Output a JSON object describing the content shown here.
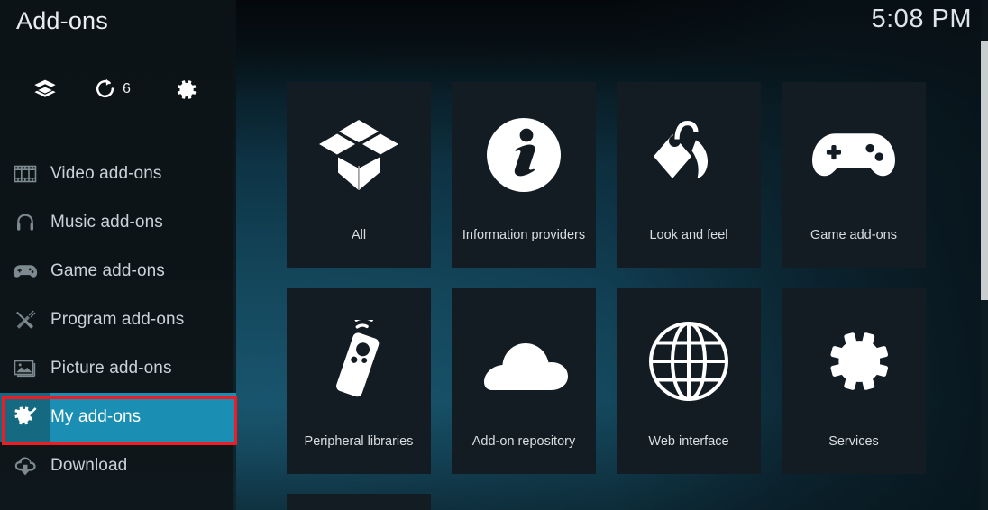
{
  "header": {
    "title": "Add-ons",
    "clock": "5:08 PM"
  },
  "sidebar": {
    "tools": [
      {
        "name": "install-from-package-icon",
        "icon": "package-icon",
        "label": ""
      },
      {
        "name": "check-for-updates-icon",
        "icon": "refresh-icon",
        "label": "6"
      },
      {
        "name": "addon-settings-icon",
        "icon": "gear-icon",
        "label": ""
      }
    ],
    "items": [
      {
        "label": "Video add-ons",
        "icon": "film-icon",
        "selected": false
      },
      {
        "label": "Music add-ons",
        "icon": "headphones-icon",
        "selected": false
      },
      {
        "label": "Game add-ons",
        "icon": "gamepad-icon",
        "selected": false
      },
      {
        "label": "Program add-ons",
        "icon": "tools-icon",
        "selected": false
      },
      {
        "label": "Picture add-ons",
        "icon": "picture-icon",
        "selected": false
      },
      {
        "label": "My add-ons",
        "icon": "my-addons-icon",
        "selected": true
      },
      {
        "label": "Download",
        "icon": "download-icon",
        "selected": false
      }
    ]
  },
  "main": {
    "tiles": [
      {
        "label": "All",
        "icon": "open-box-icon"
      },
      {
        "label": "Information providers",
        "icon": "info-circle-icon"
      },
      {
        "label": "Look and feel",
        "icon": "price-tag-icon"
      },
      {
        "label": "Game add-ons",
        "icon": "gamepad-icon"
      },
      {
        "label": "Peripheral libraries",
        "icon": "remote-control-icon"
      },
      {
        "label": "Add-on repository",
        "icon": "cloud-icon"
      },
      {
        "label": "Web interface",
        "icon": "globe-icon"
      },
      {
        "label": "Services",
        "icon": "gear-icon"
      }
    ]
  },
  "colors": {
    "accent": "#1a8fb3",
    "accent_dark": "#156980",
    "highlight_border": "#ee1c25",
    "tile_bg": "#141c23",
    "sidebar_bg": "#0d1418"
  }
}
